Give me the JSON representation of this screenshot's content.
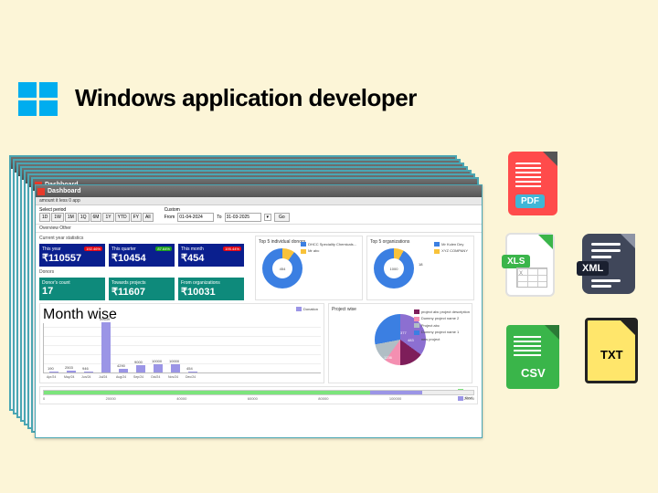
{
  "headline": "Windows application developer",
  "window": {
    "title": "Dashboard",
    "subtitle": "amount it less 0 app",
    "filter": {
      "select_label": "Select period",
      "buttons": [
        "1D",
        "1W",
        "1M",
        "1Q",
        "6M",
        "1Y",
        "YTD",
        "FY",
        "All"
      ],
      "custom_label": "Custom",
      "from_label": "From",
      "from_value": "01-04-2024",
      "to_label": "To",
      "to_value": "31-03-2025",
      "go": "Go"
    },
    "tabs": "Overview   Other",
    "stats_title": "Current year statistics",
    "stats": [
      {
        "label": "This year",
        "value": "₹110557",
        "badge": "192.46%",
        "badge_color": "red"
      },
      {
        "label": "This quarter",
        "value": "₹10454",
        "badge": "87.64%",
        "badge_color": "green"
      },
      {
        "label": "This month",
        "value": "₹454",
        "badge": "195.44%",
        "badge_color": "red"
      }
    ],
    "donors_title": "Donors",
    "donors": [
      {
        "label": "Donor's count",
        "value": "17"
      },
      {
        "label": "Towards projects",
        "value": "₹11607"
      },
      {
        "label": "From organizations",
        "value": "₹10031"
      }
    ],
    "donut1": {
      "title": "Top 5 individual donors",
      "center": "454",
      "legend": [
        "DHCC Speciality Chemicals...",
        "Mr abc"
      ]
    },
    "donut2": {
      "title": "Top 5 organizations",
      "center": "1000",
      "side_value": "18",
      "legend": [
        "Mr Kulen Dey",
        "XYZ COMPANY"
      ]
    },
    "monthwise": {
      "title": "Month wise",
      "legend": "Donation"
    },
    "projectwise": {
      "title": "Project wise",
      "labels": {
        "a": "1236",
        "b": "377",
        "c": "483"
      },
      "legend": [
        "project abc project description",
        "Dummy project name 2",
        "Project abc",
        "Dummy project name 1",
        "new project"
      ]
    },
    "cashkind": {
      "legend": [
        "Cash",
        "Kind"
      ],
      "ticks": [
        "0",
        "20000",
        "40000",
        "60000",
        "80000",
        "100000",
        "120000"
      ]
    }
  },
  "chart_data": {
    "type": "bar",
    "title": "Month wise",
    "ylabel": "Donation",
    "ylim": [
      0,
      60000
    ],
    "categories": [
      "Apr/24",
      "May/24",
      "Jun/24",
      "Jul/24",
      "Aug/24",
      "Sep/24",
      "Oct/24",
      "Nov/24",
      "Dec/24"
    ],
    "values": [
      190,
      2503,
      946,
      59639,
      4290,
      9000,
      10000,
      10000,
      454
    ]
  },
  "files": {
    "pdf": "PDF",
    "xls": "XLS",
    "xml": "XML",
    "csv": "CSV",
    "txt": "TXT"
  }
}
